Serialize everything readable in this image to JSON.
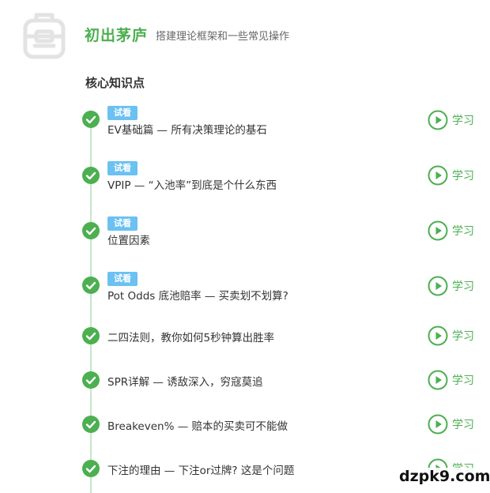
{
  "header": {
    "title": "初出茅庐",
    "subtitle": "搭建理论框架和一些常见操作",
    "icon": "backpack-icon"
  },
  "section": {
    "title": "核心知识点"
  },
  "colors": {
    "accent": "#4caf50",
    "badge": "#6bc1f2",
    "timeline": "#c8e6c9"
  },
  "lessons": [
    {
      "badge": "试看",
      "title": "EV基础篇 — 所有决策理论的基石",
      "action": "学习"
    },
    {
      "badge": "试看",
      "title": "VPIP — “入池率”到底是个什么东西",
      "action": "学习"
    },
    {
      "badge": "试看",
      "title": "位置因素",
      "action": "学习"
    },
    {
      "badge": "试看",
      "title": "Pot Odds 底池赔率 — 买卖划不划算?",
      "action": "学习"
    },
    {
      "badge": "",
      "title": "二四法则，教你如何5秒钟算出胜率",
      "action": "学习"
    },
    {
      "badge": "",
      "title": "SPR详解 — 诱敌深入，穷寇莫追",
      "action": "学习"
    },
    {
      "badge": "",
      "title": "Breakeven% — 赔本的买卖可不能做",
      "action": "学习"
    },
    {
      "badge": "",
      "title": "下注的理由 — 下注or过牌? 这是个问题",
      "action": "学习"
    }
  ],
  "watermark": {
    "text": "dzpk9.com"
  }
}
